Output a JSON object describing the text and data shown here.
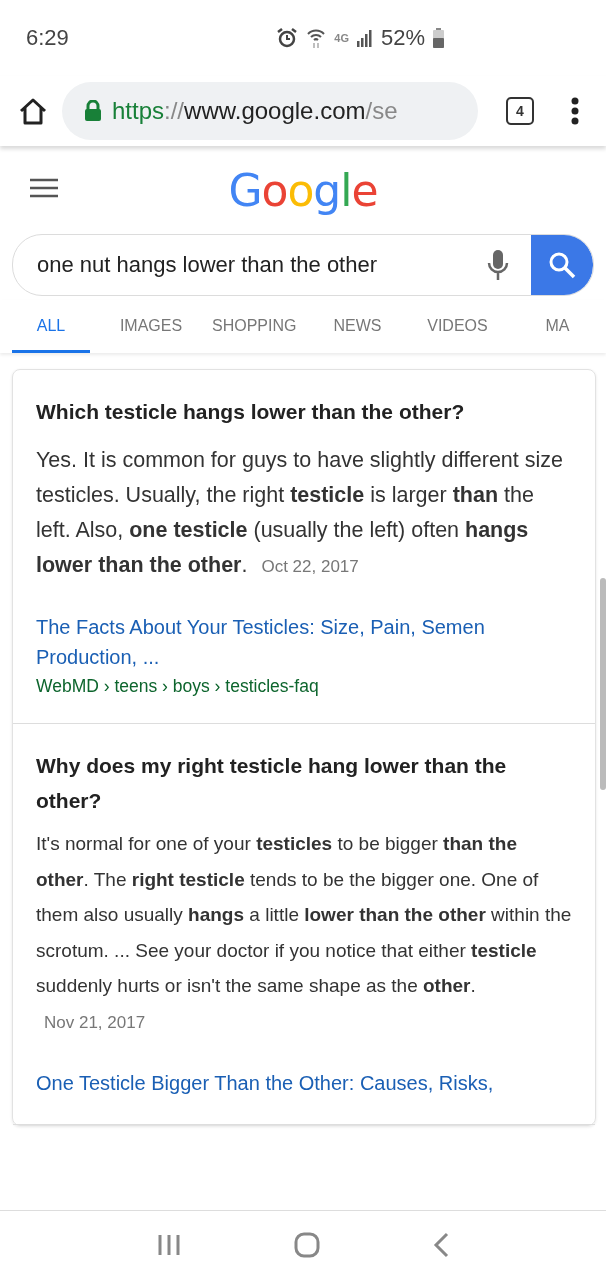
{
  "status_bar": {
    "time": "6:29",
    "battery_text": "52%",
    "network": "4G"
  },
  "browser": {
    "url": {
      "scheme": "https",
      "separator": "://",
      "host": "www.google.com",
      "path": "/se"
    },
    "tab_count": "4"
  },
  "header": {
    "logo": "Google"
  },
  "search": {
    "value": "one nut hangs lower than the other"
  },
  "tabs": [
    {
      "label": "ALL",
      "selected": true
    },
    {
      "label": "IMAGES",
      "selected": false
    },
    {
      "label": "SHOPPING",
      "selected": false
    },
    {
      "label": "NEWS",
      "selected": false
    },
    {
      "label": "VIDEOS",
      "selected": false
    },
    {
      "label": "MA",
      "selected": false
    }
  ],
  "results": [
    {
      "question": "Which testicle hangs lower than the other?",
      "answer": "Yes. It is common for guys to have slightly different size testicles. Usually, the right **testicle** is larger **than** the left. Also, **one testicle** (usually the left) often **hangs lower than the other**.",
      "date": "Oct 22, 2017",
      "link": "The Facts About Your Testicles: Size, Pain, Semen Production, ...",
      "breadcrumb": "WebMD › teens › boys › testicles-faq"
    },
    {
      "question": "Why does my right testicle hang lower than the other?",
      "answer": "It's normal for one of your **testicles** to be bigger **than the other**. The **right testicle** tends to be the bigger one. One of them also usually **hangs** a little **lower than the other** within the scrotum. ... See your doctor if you notice that either **testicle** suddenly hurts or isn't the same shape as the **other**.",
      "date": "Nov 21, 2017",
      "link": "One Testicle Bigger Than the Other: Causes, Risks,"
    }
  ]
}
